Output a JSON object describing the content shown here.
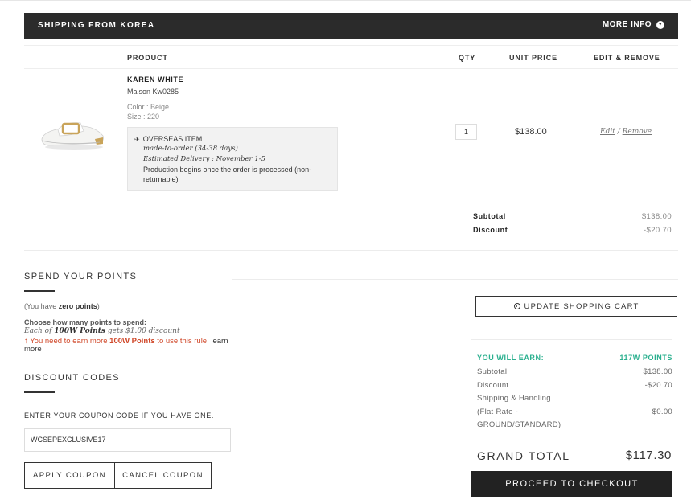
{
  "header": {
    "title": "SHIPPING FROM KOREA",
    "more_info": "MORE INFO",
    "more_info_icon": "chevron-down-circle-icon"
  },
  "table": {
    "columns": [
      "PRODUCT",
      "QTY",
      "UNIT PRICE",
      "EDIT & REMOVE"
    ]
  },
  "item": {
    "name": "KAREN WHITE",
    "sku": "Maison Kw0285",
    "color": "Color : Beige",
    "size": "Size : 220",
    "overseas_icon": "plane-icon",
    "overseas_title": "OVERSEAS ITEM",
    "made_to_order": "made-to-order (34-38 days)",
    "estimated_delivery": "Estimated Delivery : November 1-5",
    "production_note": "Production begins once the order is processed (non-returnable)",
    "qty": "1",
    "unit_price": "$138.00",
    "edit_label": "Edit",
    "separator": "/",
    "remove_label": "Remove"
  },
  "cart_totals": {
    "subtotal_label": "Subtotal",
    "subtotal_value": "$138.00",
    "discount_label": "Discount",
    "discount_value": "-$20.70"
  },
  "points": {
    "title": "SPEND YOUR POINTS",
    "you_have_prefix": "(You have ",
    "you_have_bold": "zero points",
    "you_have_suffix": ")",
    "choose_label": "Choose how many points to spend:",
    "each_prefix": "Each of ",
    "each_bold": "100W Points",
    "each_suffix": " gets $1.00 discount",
    "warn_icon": "arrow-up-icon",
    "warn_prefix": " You need to earn more ",
    "warn_bold": "100W Points",
    "warn_suffix": " to use this rule.",
    "learn_more": "learn more"
  },
  "discount": {
    "title": "DISCOUNT CODES",
    "label": "ENTER YOUR COUPON CODE IF YOU HAVE ONE.",
    "code_value": "WCSEPEXCLUSIVE17",
    "apply_label": "APPLY COUPON",
    "cancel_label": "CANCEL COUPON"
  },
  "summary": {
    "update_icon": "refresh-circle-icon",
    "update_label": "UPDATE SHOPPING CART",
    "earn_label": "YOU WILL EARN:",
    "earn_value": "117W POINTS",
    "subtotal_label": "Subtotal",
    "subtotal_value": "$138.00",
    "discount_label": "Discount",
    "discount_value": "-$20.70",
    "shipping_line1": "Shipping & Handling",
    "shipping_line2": "(Flat Rate -",
    "shipping_line3": "GROUND/STANDARD)",
    "shipping_value": "$0.00",
    "grand_total_label": "GRAND TOTAL",
    "grand_total_value": "$117.30",
    "checkout_label": "PROCEED TO CHECKOUT"
  },
  "colors": {
    "dark": "#2b2b2b",
    "accent_green": "#2bb08f",
    "warning_red": "#d0492b"
  }
}
